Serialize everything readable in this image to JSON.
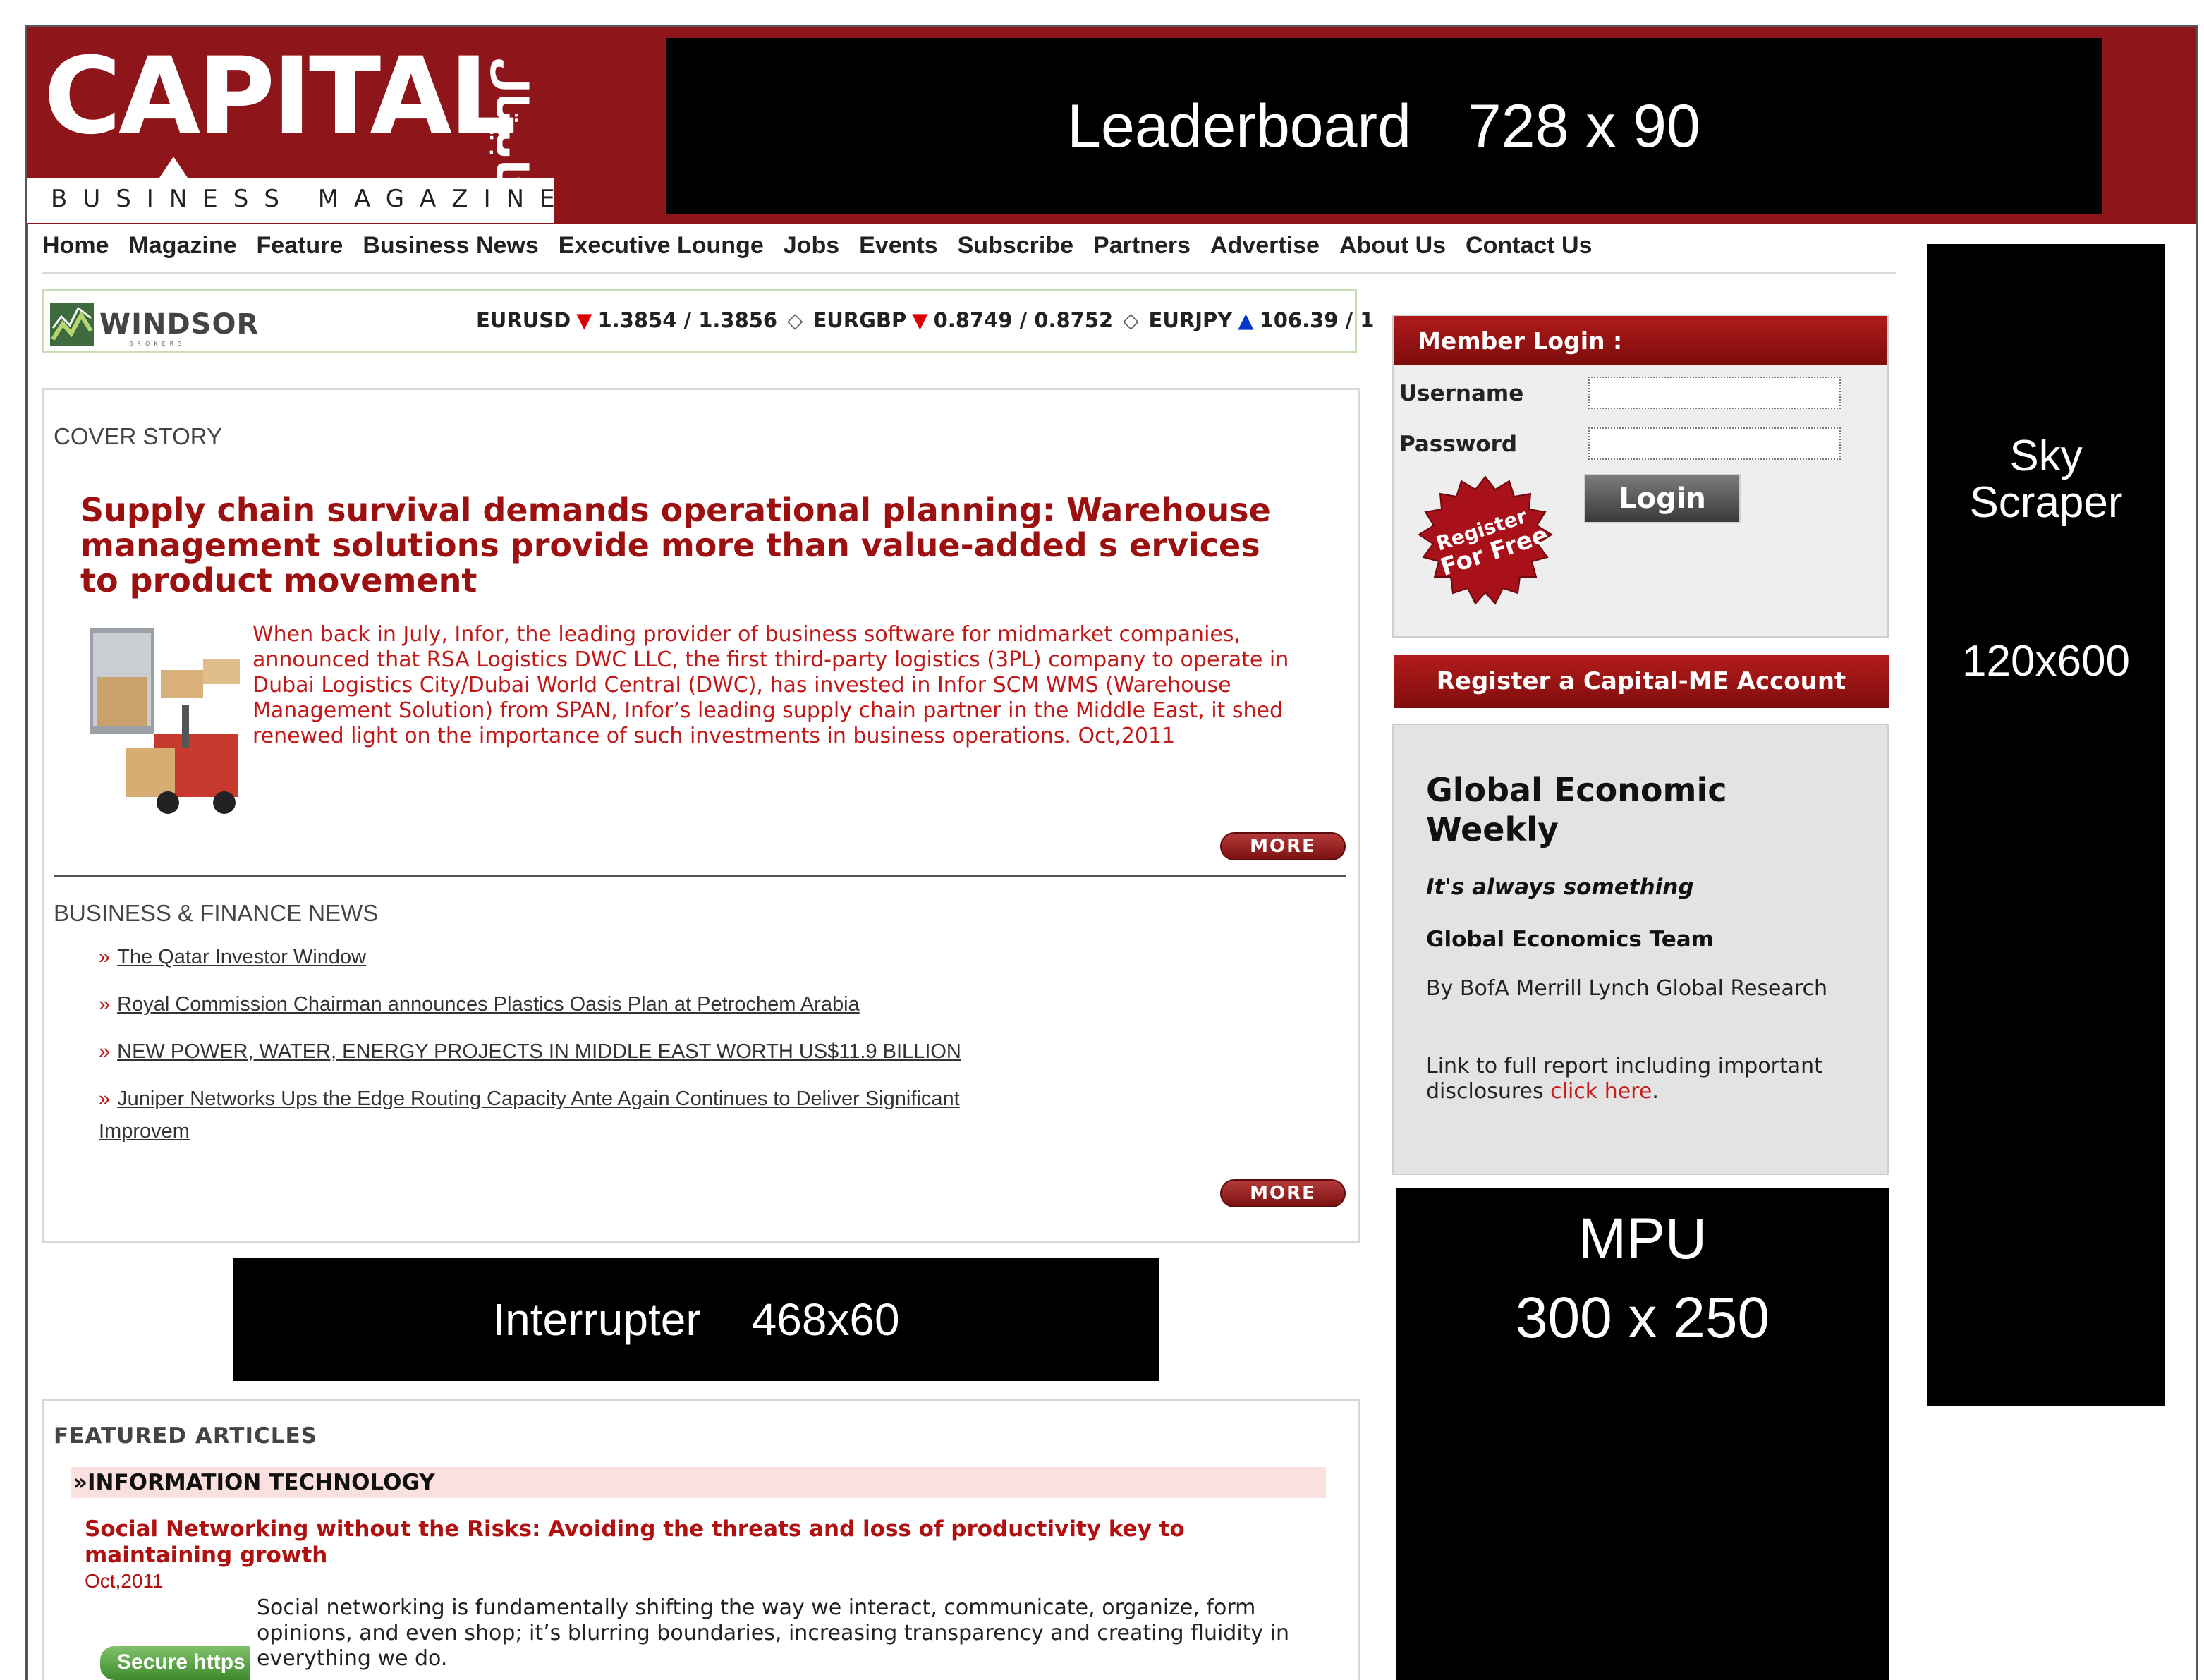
{
  "header": {
    "logo_text": "CAPITAL",
    "logo_arabic": "كابيتال",
    "logo_subtitle": "BUSINESS MAGAZINE",
    "leaderboard_name": "Leaderboard",
    "leaderboard_size": "728 x 90"
  },
  "nav": {
    "items": [
      "Home",
      "Magazine",
      "Feature",
      "Business News",
      "Executive Lounge",
      "Jobs",
      "Events",
      "Subscribe",
      "Partners",
      "Advertise",
      "About Us",
      "Contact Us"
    ]
  },
  "ticker": {
    "brand": "WINDSOR",
    "brand_sub": "BROKERS",
    "rates": [
      {
        "pair": "EURUSD",
        "direction": "down",
        "value": "1.3854 / 1.3856"
      },
      {
        "pair": "EURGBP",
        "direction": "down",
        "value": "0.8749 / 0.8752"
      },
      {
        "pair": "EURJPY",
        "direction": "up",
        "value": "106.39 / 1"
      }
    ],
    "separator": "◇"
  },
  "cover_story": {
    "label": "COVER STORY",
    "title": "Supply chain survival demands operational planning: Warehouse management solutions provide more than value-added s ervices to product movement",
    "body": "When back in July, Infor, the leading provider of business software for midmarket companies, announced that RSA Logistics DWC LLC, the first third-party logistics (3PL) company to operate in Dubai Logistics City/Dubai World Central (DWC), has invested in Infor SCM WMS (Warehouse Management Solution) from SPAN, Infor’s leading supply chain partner in the Middle East, it shed renewed light on the importance of such investments in business operations. Oct,2011",
    "more_label": "MORE"
  },
  "business_news": {
    "label": "BUSINESS & FINANCE NEWS",
    "bullet": "»",
    "items": [
      "The Qatar Investor Window",
      "Royal Commission Chairman announces Plastics Oasis Plan at Petrochem Arabia",
      "NEW POWER, WATER, ENERGY PROJECTS IN MIDDLE EAST WORTH US$11.9 BILLION",
      "Juniper Networks Ups the Edge Routing Capacity Ante Again   Continues to Deliver Significant Improvem"
    ],
    "more_label": "MORE"
  },
  "interrupter": {
    "name": "Interrupter",
    "size": "468x60"
  },
  "featured": {
    "label": "FEATURED ARTICLES",
    "category": "»INFORMATION TECHNOLOGY",
    "title": "Social Networking without the Risks: Avoiding the threats and loss of productivity key to maintaining growth",
    "date": "Oct,2011",
    "body": "Social networking is fundamentally shifting the way we interact, communicate, organize, form opinions, and even shop; it’s blurring boundaries, increasing transparency and creating fluidity in everything we do.",
    "image_text": "Secure https"
  },
  "login": {
    "heading": "Member Login :",
    "username_label": "Username",
    "password_label": "Password",
    "username_value": "",
    "password_value": "",
    "button_label": "Login",
    "register_seal_line1": "Register",
    "register_seal_line2": "For Free"
  },
  "register_account": {
    "label": "Register a Capital-ME Account"
  },
  "global_economic": {
    "title": "Global Economic Weekly",
    "tagline": "It's always something",
    "team": "Global Economics Team",
    "by": "By BofA Merrill Lynch Global Research",
    "link_prefix": "Link to full report including important disclosures ",
    "link_text": "click here",
    "link_suffix": "."
  },
  "mpu": {
    "name": "MPU",
    "size": "300 x 250"
  },
  "skyscraper": {
    "line1": "Sky",
    "line2": "Scraper",
    "size": "120x600"
  },
  "colors": {
    "brand_red": "#8e1519",
    "headline_red": "#9c1010",
    "body_red": "#c21818",
    "ad_black": "#000000"
  }
}
